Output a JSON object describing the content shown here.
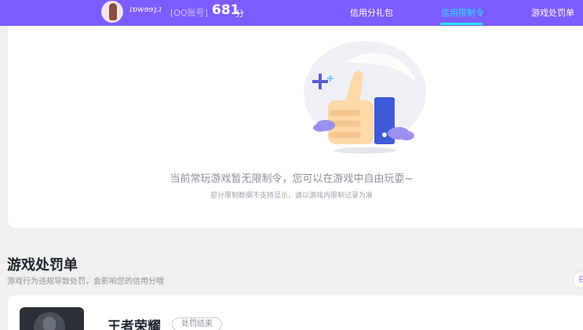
{
  "header": {
    "nickname": "ɪɒwɘɘʇ.ɪ",
    "account_label": "[QQ账号]",
    "score": "681",
    "score_unit": "分",
    "nav": [
      {
        "label": "信用分礼包",
        "active": false
      },
      {
        "label": "信用限制令",
        "active": true
      },
      {
        "label": "游戏处罚单",
        "active": false
      }
    ],
    "accent_color": "#7b5cff",
    "active_color": "#27e0ff"
  },
  "empty_state": {
    "icon": "thumbs-up-icon",
    "message": "当前常玩游戏暂无限制令，您可以在游戏中自由玩耍~",
    "note": "部分限制数据不支持显示，请以游戏内限制记录为准"
  },
  "penalty_section": {
    "title": "游戏处罚单",
    "subtitle": "游戏行为违规导致处罚，会影响您的信用分哦",
    "right_button": "召",
    "items": [
      {
        "game": "王者荣耀",
        "status": "处罚结束"
      }
    ]
  }
}
